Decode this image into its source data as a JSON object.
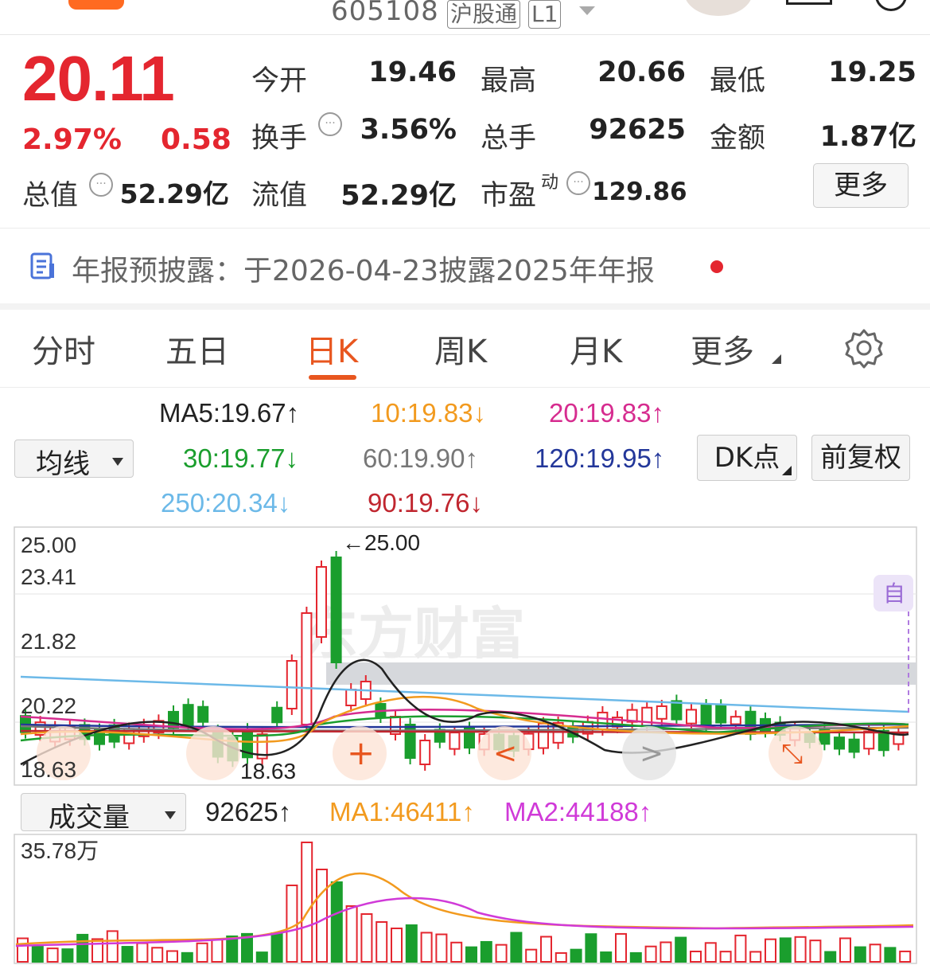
{
  "header": {
    "code": "605108",
    "market_tag": "沪股通",
    "level_tag": "L1"
  },
  "quote": {
    "price": "20.11",
    "change_pct": "2.97%",
    "change": "0.58",
    "rows": [
      [
        {
          "label": "今开",
          "value": "19.46",
          "color": "green"
        },
        {
          "label": "最高",
          "value": "20.66",
          "color": "red"
        },
        {
          "label": "最低",
          "value": "19.25",
          "color": "green"
        }
      ],
      [
        {
          "label": "换手",
          "value": "3.56%",
          "color": "black"
        },
        {
          "label": "总手",
          "value": "92625",
          "color": "black"
        },
        {
          "label": "金额",
          "value": "1.87亿",
          "color": "black"
        }
      ]
    ],
    "total_value_label": "总值",
    "total_value": "52.29亿",
    "float_value_label": "流值",
    "float_value": "52.29亿",
    "pe_label": "市盈",
    "pe_sup": "动",
    "pe_value": "129.86",
    "more_label": "更多"
  },
  "notice": {
    "text": "年报预披露：于2026-04-23披露2025年年报"
  },
  "tabs": [
    "分时",
    "五日",
    "日K",
    "周K",
    "月K",
    "更多"
  ],
  "active_tab": "日K",
  "ma": {
    "selector": "均线",
    "items": [
      {
        "text": "MA5:19.67↑",
        "color": "#222222"
      },
      {
        "text": "10:19.83↓",
        "color": "#f29a1e"
      },
      {
        "text": "20:19.83↑",
        "color": "#d62c8f"
      },
      {
        "text": "30:19.77↓",
        "color": "#1a9e2d"
      },
      {
        "text": "60:19.90↑",
        "color": "#777777"
      },
      {
        "text": "120:19.95↑",
        "color": "#23379a"
      },
      {
        "text": "250:20.34↓",
        "color": "#6cb9e8"
      },
      {
        "text": "90:19.76↓",
        "color": "#c0262f"
      }
    ],
    "dk_button": "DK点",
    "adjust_button": "前复权"
  },
  "kline": {
    "y_labels": [
      "25.00",
      "23.41",
      "21.82",
      "20.22",
      "18.63"
    ],
    "max_marker": "←25.00",
    "min_marker": "18.63",
    "auto_badge": "自",
    "watermark": "东方财富"
  },
  "volume": {
    "selector": "成交量",
    "current": "92625↑",
    "ma1": "MA1:46411↑",
    "ma2": "MA2:44188↑",
    "max_label": "35.78万"
  },
  "colors": {
    "up": "#e4262f",
    "down": "#1a9e2d",
    "accent": "#e8561f"
  }
}
